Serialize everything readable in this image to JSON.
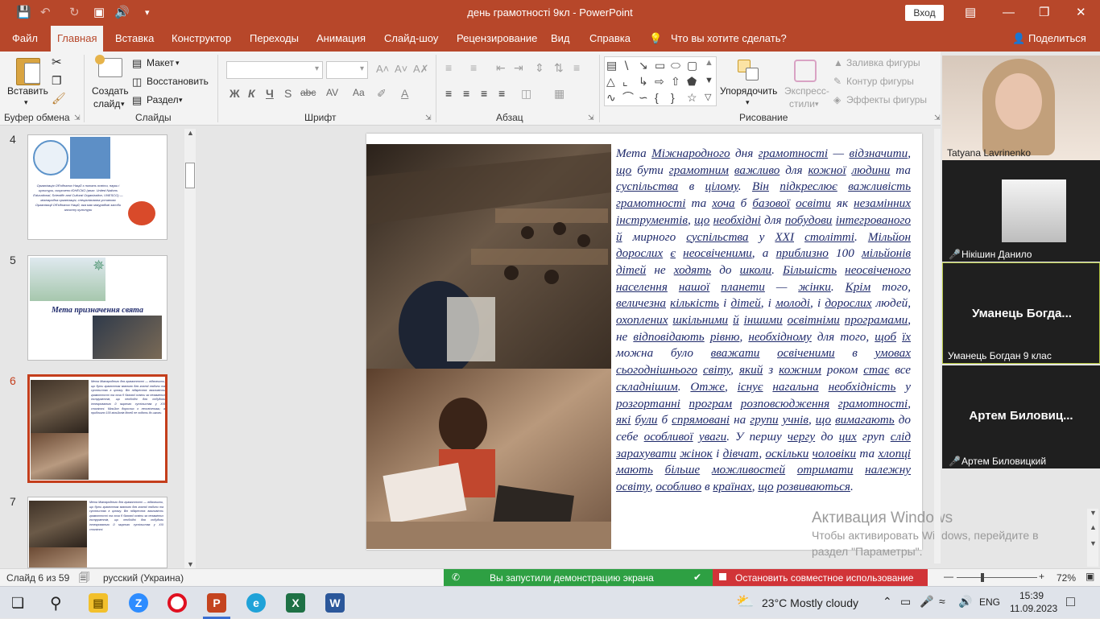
{
  "window": {
    "title": "день грамотності 9кл  -  PowerPoint",
    "signin_label": "Вход"
  },
  "tabs": [
    "Файл",
    "Главная",
    "Вставка",
    "Конструктор",
    "Переходы",
    "Анимация",
    "Слайд-шоу",
    "Рецензирование",
    "Вид",
    "Справка"
  ],
  "active_tab": "Главная",
  "tell_me": "Что вы хотите сделать?",
  "share_label": "Поделиться",
  "ribbon": {
    "clipboard": {
      "paste": "Вставить",
      "group": "Буфер обмена"
    },
    "slides": {
      "new_slide_1": "Создать",
      "new_slide_2": "слайд",
      "layout": "Макет",
      "reset": "Восстановить",
      "section": "Раздел",
      "group": "Слайды"
    },
    "font": {
      "group": "Шрифт"
    },
    "paragraph": {
      "group": "Абзац"
    },
    "drawing": {
      "arrange": "Упорядочить",
      "quick_styles_1": "Экспресс-",
      "quick_styles_2": "стили",
      "fill": "Заливка фигуры",
      "outline": "Контур фигуры",
      "effects": "Эффекты фигуры",
      "group": "Рисование"
    }
  },
  "thumbnails": {
    "slide4": {
      "num": "4",
      "text": "Організація Об'єднаних Націй з питань освіти, науки і культури, скорочено ЮНЕСКО (англ. United Nations Educational, Scientific and Cultural Organization, UNESCO) — міжнародна організація, спеціалізована установа Організації Об'єднаних Націй, яка має міжурядові засоби захисту культури"
    },
    "slide5": {
      "num": "5",
      "title": "Мета призначення  свята"
    },
    "slide6": {
      "num": "6",
      "text": "Мета Міжнародного дня грамотності — відзначити, що бути грамотним важливо для кожної людини та суспільства в цілому. Він підкреслює важливість грамотності та хоча б базової освіти як незамінних інструментів, що необхідні для побудови інтегрованого й мирного суспільства у XXI столітті. Мільйон дорослих є неосвіченими, а приблизно 100 мільйонів дітей не ходять до школи."
    },
    "slide7": {
      "num": "7",
      "text": "Мета Міжнародного дня грамотності — відзначити, що бути грамотним важливо для кожної людини та суспільства в цілому. Він підкреслює важливість грамотності та хоча б базової освіти як незамінних інструментів, що необхідні для побудови інтегрованого й мирного суспільства у XXI столітті."
    }
  },
  "slide_text_parts": [
    "Мета ",
    {
      "u": "Міжнародного"
    },
    " дня ",
    {
      "u": "грамотності"
    },
    " — ",
    {
      "u": "відзначити"
    },
    ", ",
    {
      "u": "що"
    },
    " бути ",
    {
      "u": "грамотним"
    },
    " ",
    {
      "u": "важливо"
    },
    " для ",
    {
      "u": "кожної"
    },
    " ",
    {
      "u": "людини"
    },
    " та ",
    {
      "u": "суспільства"
    },
    " в ",
    {
      "u": "цілому"
    },
    ". ",
    {
      "u": "Він"
    },
    " ",
    {
      "u": "підкреслює"
    },
    " ",
    {
      "u": "важливість"
    },
    " ",
    {
      "u": "грамотності"
    },
    " та ",
    {
      "u": "хоча"
    },
    " б ",
    {
      "u": "базової"
    },
    " ",
    {
      "u": "освіти"
    },
    " як ",
    {
      "u": "незамінних"
    },
    " ",
    {
      "u": "інструментів"
    },
    ", ",
    {
      "u": "що"
    },
    " ",
    {
      "u": "необхідні"
    },
    " для ",
    {
      "u": "побудови"
    },
    " ",
    {
      "u": "інтегрованого"
    },
    " ",
    {
      "u": "й"
    },
    " ",
    "мирного ",
    {
      "u": "суспільства"
    },
    " у ",
    {
      "u": "XXI"
    },
    " ",
    {
      "u": "столітті"
    },
    ". ",
    {
      "u": "Мільйон"
    },
    " ",
    {
      "u": "дорослих"
    },
    " ",
    {
      "u": "є"
    },
    " ",
    {
      "u": "неосвіченими"
    },
    ", а ",
    {
      "u": "приблизно"
    },
    " 100 ",
    {
      "u": "мільйонів"
    },
    " ",
    {
      "u": "дітей"
    },
    " не ",
    {
      "u": "ходять"
    },
    " до ",
    {
      "u": "школи"
    },
    ". ",
    {
      "u": "Більшість"
    },
    " ",
    {
      "u": "неосвіченого"
    },
    " ",
    {
      "u": "населення"
    },
    " ",
    {
      "u": "нашої"
    },
    " ",
    {
      "u": "планети"
    },
    " — ",
    {
      "u": "жінки"
    },
    ". ",
    {
      "u": "Крім"
    },
    " того, ",
    {
      "u": "величезна"
    },
    " ",
    {
      "u": "кількість"
    },
    " і ",
    {
      "u": "дітей"
    },
    ", і ",
    {
      "u": "молоді"
    },
    ", і ",
    {
      "u": "дорослих"
    },
    " людей, ",
    {
      "u": "охоплених"
    },
    " ",
    {
      "u": "шкільними"
    },
    " ",
    {
      "u": "й"
    },
    " ",
    {
      "u": "іншими"
    },
    " ",
    {
      "u": "освітніми"
    },
    " ",
    {
      "u": "програмами"
    },
    ", не ",
    {
      "u": "відповідають"
    },
    " ",
    {
      "u": "рівню"
    },
    ", ",
    {
      "u": "необхідному"
    },
    " для того, ",
    {
      "u": "щоб"
    },
    " ",
    {
      "u": "їх"
    },
    " можна було ",
    {
      "u": "вважати"
    },
    " ",
    {
      "u": "освіченими"
    },
    " в ",
    {
      "u": "умовах"
    },
    " ",
    {
      "u": "сьогоднішнього"
    },
    " ",
    {
      "u": "світу"
    },
    ", ",
    {
      "u": "який"
    },
    " з ",
    {
      "u": "кожним"
    },
    " роком ",
    {
      "u": "стає"
    },
    " все ",
    {
      "u": "складнішим"
    },
    ". ",
    {
      "u": "Отже"
    },
    ", ",
    {
      "u": "існує"
    },
    " ",
    {
      "u": "нагальна"
    },
    " ",
    {
      "u": "необхідність"
    },
    " у ",
    {
      "u": "розгортанні"
    },
    " ",
    {
      "u": "програм"
    },
    " ",
    {
      "u": "розповсюдження"
    },
    " ",
    {
      "u": "грамотності"
    },
    ", ",
    {
      "u": "які"
    },
    " ",
    {
      "u": "були"
    },
    " б ",
    {
      "u": "спрямовані"
    },
    " на ",
    {
      "u": "групи"
    },
    " ",
    {
      "u": "учнів"
    },
    ", ",
    {
      "u": "що"
    },
    " ",
    {
      "u": "вимагають"
    },
    " до ",
    "себе ",
    {
      "u": "особливої"
    },
    " ",
    {
      "u": "уваги"
    },
    ". У першу ",
    {
      "u": "чергу"
    },
    " до ",
    {
      "u": "цих"
    },
    " груп ",
    {
      "u": "слід"
    },
    " ",
    {
      "u": "зарахувати"
    },
    " ",
    {
      "u": "жінок"
    },
    " і ",
    {
      "u": "дівчат"
    },
    ",",
    " ",
    {
      "u": "оскільки"
    },
    " ",
    {
      "u": "чоловіки"
    },
    " та ",
    {
      "u": "хлопці"
    },
    " ",
    {
      "u": "мають"
    },
    " ",
    {
      "u": "більше"
    },
    " ",
    {
      "u": "можливостей"
    },
    " ",
    {
      "u": "отримати"
    },
    " ",
    {
      "u": "належну"
    },
    " ",
    {
      "u": "освіту"
    },
    ", ",
    {
      "u": "особливо"
    },
    " в ",
    {
      "u": "країнах"
    },
    ", ",
    {
      "u": "що"
    },
    " ",
    {
      "u": "розвиваються"
    },
    "."
  ],
  "watermark": {
    "title": "Активация Windows",
    "subtitle_1": "Чтобы активировать Windows, перейдите в",
    "subtitle_2": "раздел \"Параметры\"."
  },
  "participants": [
    {
      "name": "Tatyana Lavrinenko",
      "muted": false
    },
    {
      "name": "Нікішин Данило",
      "muted": true
    },
    {
      "name": "Уманець Богдан 9 клас",
      "big": "Уманець  Богда...",
      "muted": false
    },
    {
      "name": "Артем Биловицкий",
      "big": "Артем  Биловиц...",
      "muted": true
    }
  ],
  "status": {
    "slide_counter": "Слайд 6 из 59",
    "language": "русский (Украина)",
    "sharing": "Вы запустили демонстрацию экрана",
    "stop_sharing": "Остановить совместное использование",
    "zoom": "72%"
  },
  "taskbar": {
    "weather": "23°C  Mostly cloudy",
    "lang": "ENG",
    "time": "15:39",
    "date": "11.09.2023"
  },
  "colors": {
    "brand": "#b7472a",
    "slide_text": "#1f2a6b",
    "share_green": "#2ea043",
    "stop_red": "#d13438"
  }
}
